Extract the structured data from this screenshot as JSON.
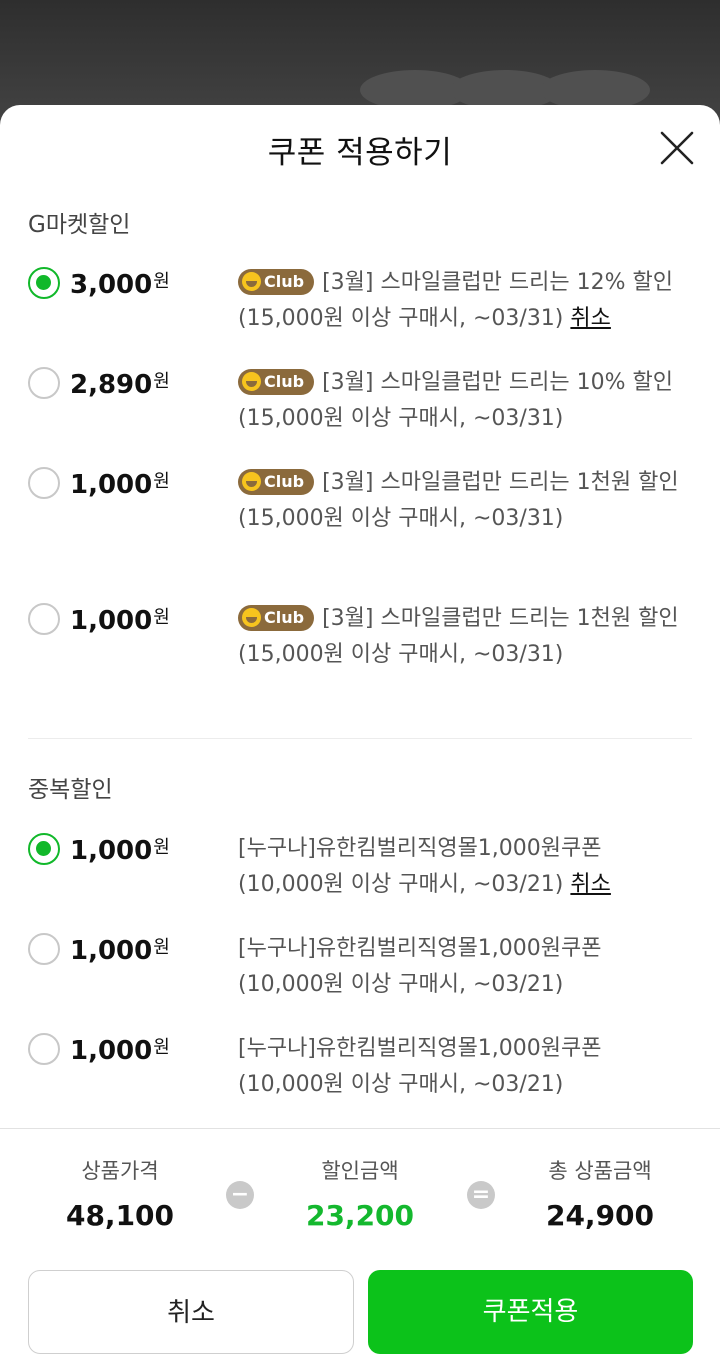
{
  "modal": {
    "title": "쿠폰 적용하기"
  },
  "sections": [
    {
      "title": "G마켓할인",
      "coupons": [
        {
          "amount": "3,000",
          "unit": "원",
          "selected": true,
          "badge": "Club",
          "name": "[3월] 스마일클럽만 드리는 12% 할인",
          "condition": "(15,000원 이상 구매시, ~03/31)",
          "cancel_label": "취소"
        },
        {
          "amount": "2,890",
          "unit": "원",
          "selected": false,
          "badge": "Club",
          "name": "[3월] 스마일클럽만 드리는 10% 할인",
          "condition": "(15,000원 이상 구매시, ~03/31)"
        },
        {
          "amount": "1,000",
          "unit": "원",
          "selected": false,
          "badge": "Club",
          "name": "[3월] 스마일클럽만 드리는 1천원 할인",
          "condition": "(15,000원 이상 구매시, ~03/31)"
        },
        {
          "amount": "1,000",
          "unit": "원",
          "selected": false,
          "badge": "Club",
          "name": "[3월] 스마일클럽만 드리는 1천원 할인",
          "condition": "(15,000원 이상 구매시, ~03/31)"
        }
      ]
    },
    {
      "title": "중복할인",
      "coupons": [
        {
          "amount": "1,000",
          "unit": "원",
          "selected": true,
          "name": "[누구나]유한킴벌리직영몰1,000원쿠폰",
          "condition": "(10,000원 이상 구매시, ~03/21)",
          "cancel_label": "취소"
        },
        {
          "amount": "1,000",
          "unit": "원",
          "selected": false,
          "name": "[누구나]유한킴벌리직영몰1,000원쿠폰",
          "condition": "(10,000원 이상 구매시, ~03/21)"
        },
        {
          "amount": "1,000",
          "unit": "원",
          "selected": false,
          "name": "[누구나]유한킴벌리직영몰1,000원쿠폰",
          "condition": "(10,000원 이상 구매시, ~03/21)"
        }
      ]
    }
  ],
  "summary": {
    "price_label": "상품가격",
    "price_value": "48,100",
    "minus_symbol": "−",
    "discount_label": "할인금액",
    "discount_value": "23,200",
    "equals_symbol": "=",
    "total_label": "총 상품금액",
    "total_value": "24,900"
  },
  "buttons": {
    "cancel_label": "취소",
    "apply_label": "쿠폰적용"
  },
  "colors": {
    "accent_green": "#0cc21a",
    "discount_green": "#14b82e",
    "club_badge": "#8b6a3c"
  },
  "icons": {
    "close": "close-icon",
    "club_badge": "smile-club-icon"
  }
}
